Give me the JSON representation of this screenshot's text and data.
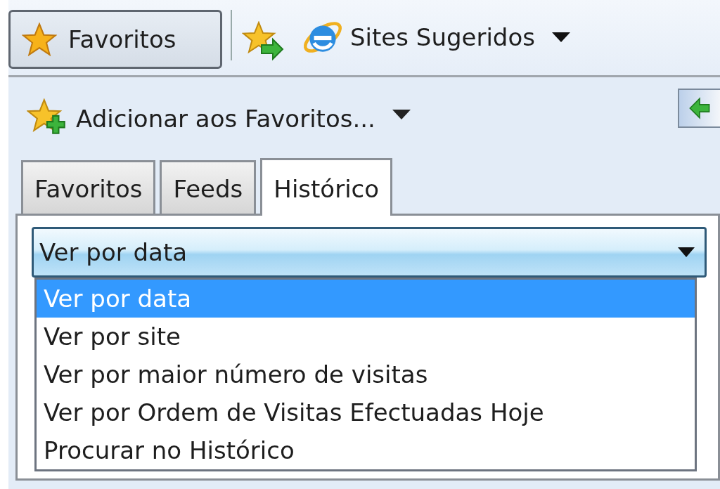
{
  "toolbar": {
    "favorites_button": "Favoritos",
    "suggested_sites": "Sites Sugeridos"
  },
  "add_to_favorites": "Adicionar aos Favoritos...",
  "tabs": [
    {
      "label": "Favoritos",
      "selected": false
    },
    {
      "label": "Feeds",
      "selected": false
    },
    {
      "label": "Histórico",
      "selected": true
    }
  ],
  "view_select": {
    "value": "Ver por data"
  },
  "options": [
    {
      "label": "Ver por data",
      "selected": true
    },
    {
      "label": "Ver por site",
      "selected": false
    },
    {
      "label": "Ver por maior número de visitas",
      "selected": false
    },
    {
      "label": "Ver por Ordem de Visitas Efectuadas Hoje",
      "selected": false
    },
    {
      "label": "Procurar no Histórico",
      "selected": false
    }
  ]
}
